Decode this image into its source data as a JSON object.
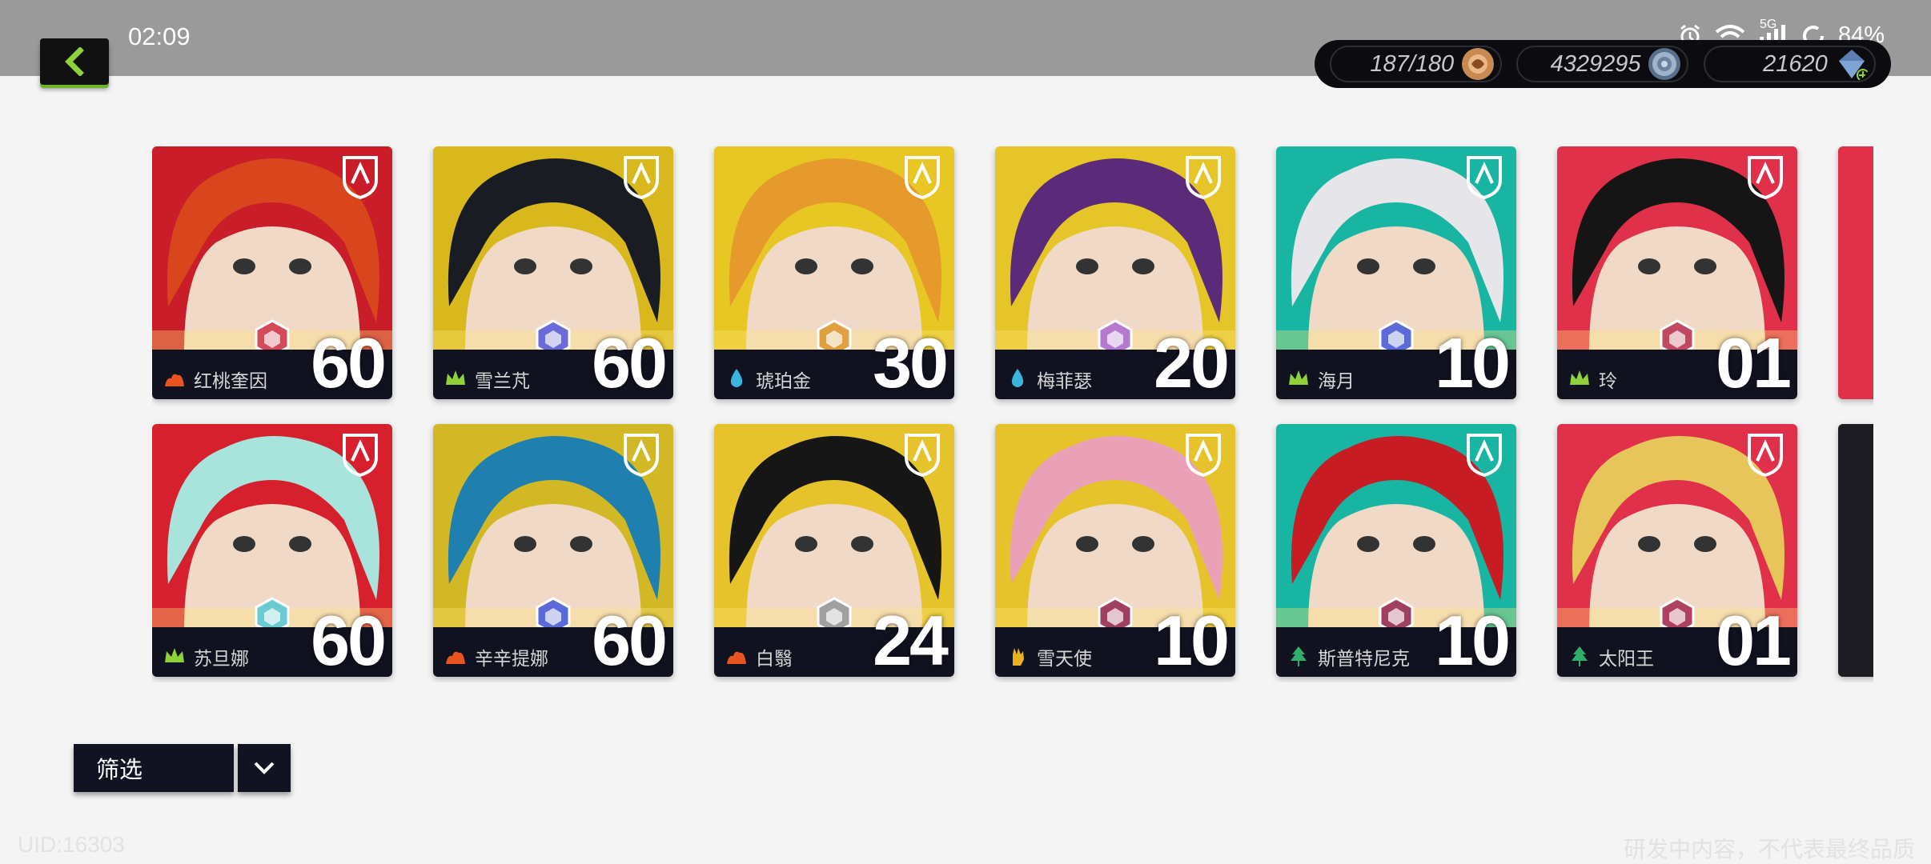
{
  "status_bar": {
    "time": "02:09",
    "signal_label": "5G",
    "battery": "84%"
  },
  "resources": [
    {
      "value": "187/180",
      "icon": "stamina-icon",
      "color": "#c98a52"
    },
    {
      "value": "4329295",
      "icon": "coin-icon",
      "color": "#7f97b4"
    },
    {
      "value": "21620",
      "icon": "gem-icon",
      "color": "#5a7fb0"
    }
  ],
  "characters": [
    {
      "name": "红桃奎因",
      "level": "60",
      "bg": "#c91d2a",
      "element": "fire-icon",
      "element_color": "#e8541e",
      "rank_color": "#d44a5a",
      "hair": "#d9451c"
    },
    {
      "name": "雪兰芃",
      "level": "60",
      "bg": "#d9b81d",
      "element": "crown-icon",
      "element_color": "#8fd13a",
      "rank_color": "#6a6ad8",
      "hair": "#1a1c24"
    },
    {
      "name": "琥珀金",
      "level": "30",
      "bg": "#e8c624",
      "element": "water-drop-icon",
      "element_color": "#3bb4e0",
      "rank_color": "#e0a040",
      "hair": "#e79a2c"
    },
    {
      "name": "梅菲瑟",
      "level": "20",
      "bg": "#e6c528",
      "element": "water-drop-icon",
      "element_color": "#3bb4e0",
      "rank_color": "#b679d0",
      "hair": "#5b2b7a"
    },
    {
      "name": "海月",
      "level": "10",
      "bg": "#18b5a3",
      "element": "crown-icon",
      "element_color": "#8fd13a",
      "rank_color": "#5a6ad8",
      "hair": "#e6e6ea"
    },
    {
      "name": "玲",
      "level": "01",
      "bg": "#e0304a",
      "element": "crown-icon",
      "element_color": "#8fd13a",
      "rank_color": "#c04860",
      "hair": "#151515"
    },
    {
      "name": "苏旦娜",
      "level": "60",
      "bg": "#d6202e",
      "element": "crown-icon",
      "element_color": "#8fd13a",
      "rank_color": "#6acbd0",
      "hair": "#a8e4dc"
    },
    {
      "name": "辛辛提娜",
      "level": "60",
      "bg": "#d3b826",
      "element": "fire-icon",
      "element_color": "#e8541e",
      "rank_color": "#5a6ad8",
      "hair": "#1f7fae"
    },
    {
      "name": "白翳",
      "level": "24",
      "bg": "#e6c32a",
      "element": "fire-icon",
      "element_color": "#e8541e",
      "rank_color": "#a0a0a0",
      "hair": "#161616"
    },
    {
      "name": "雪天使",
      "level": "10",
      "bg": "#e6c32a",
      "element": "hand-icon",
      "element_color": "#e8b21e",
      "rank_color": "#a04060",
      "hair": "#eaa0b6"
    },
    {
      "name": "斯普特尼克",
      "level": "10",
      "bg": "#18b5a3",
      "element": "tree-icon",
      "element_color": "#2fb06a",
      "rank_color": "#a04060",
      "hair": "#c81c24"
    },
    {
      "name": "太阳王",
      "level": "01",
      "bg": "#e0304a",
      "element": "tree-icon",
      "element_color": "#2fb06a",
      "rank_color": "#b04060",
      "hair": "#e6c65a"
    }
  ],
  "filter": {
    "label": "筛选"
  },
  "footer": {
    "uid": "UID:16303",
    "disclaimer": "研发中内容，不代表最终品质"
  }
}
